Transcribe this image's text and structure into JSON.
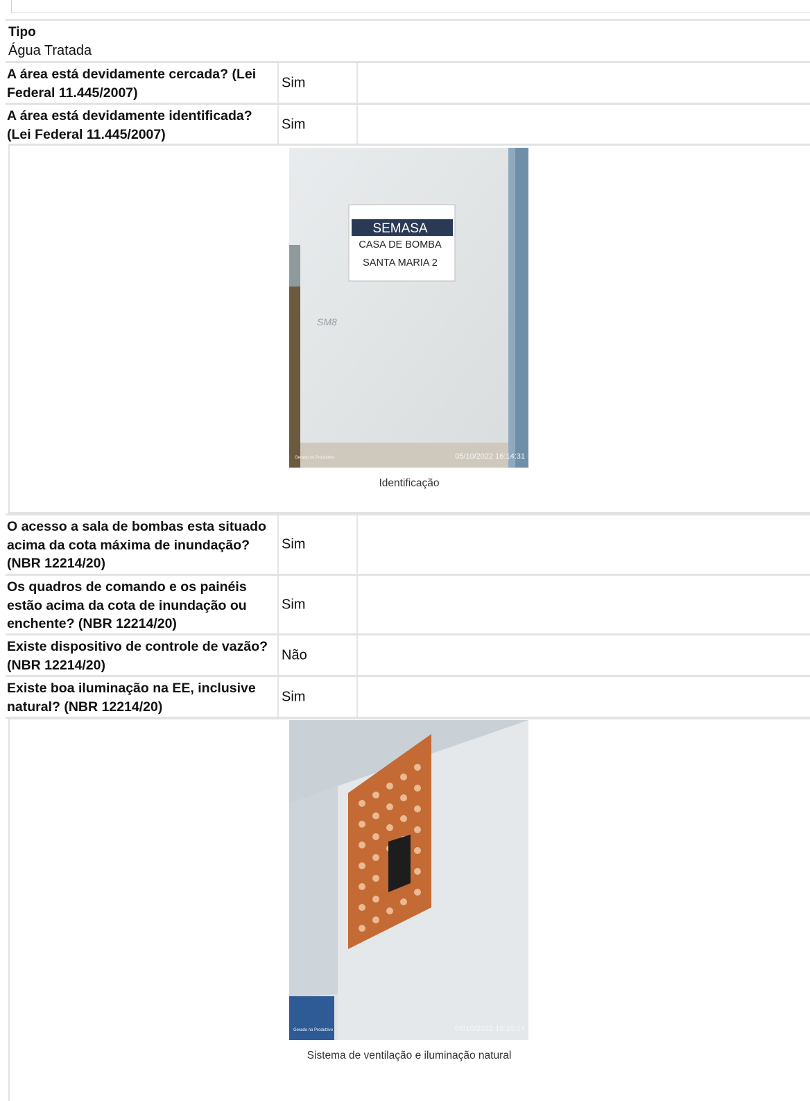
{
  "tipo": {
    "label": "Tipo",
    "value": "Água Tratada"
  },
  "rows_group1": [
    {
      "question": "A área está devidamente cercada? (Lei Federal 11.445/2007)",
      "answer": "Sim"
    },
    {
      "question": "A área está devidamente identificada? (Lei Federal 11.445/2007)",
      "answer": "Sim"
    }
  ],
  "photo1": {
    "caption": "Identificação",
    "sign_line1": "SEMASA",
    "sign_line2": "CASA DE BOMBA",
    "sign_line3": "SANTA MARIA 2",
    "wall_scribble": "SM8",
    "watermark": "Gerado no Produttivo",
    "timestamp": "05/10/2022 16:14:31"
  },
  "rows_group2": [
    {
      "question": "O acesso a sala de bombas esta situado acima da cota máxima de inundação? (NBR 12214/20)",
      "answer": "Sim"
    },
    {
      "question": "Os quadros de comando e os painéis estão acima da cota de inundação ou enchente? (NBR 12214/20)",
      "answer": "Sim"
    },
    {
      "question": "Existe dispositivo de controle de vazão? (NBR 12214/20)",
      "answer": "Não"
    },
    {
      "question": "Existe boa iluminação na EE, inclusive natural? (NBR 12214/20)",
      "answer": "Sim"
    }
  ],
  "photo2": {
    "caption": "Sistema de ventilação e iluminação natural",
    "watermark": "Gerado no Produttivo",
    "timestamp": "05/10/2022 16:15:14"
  }
}
